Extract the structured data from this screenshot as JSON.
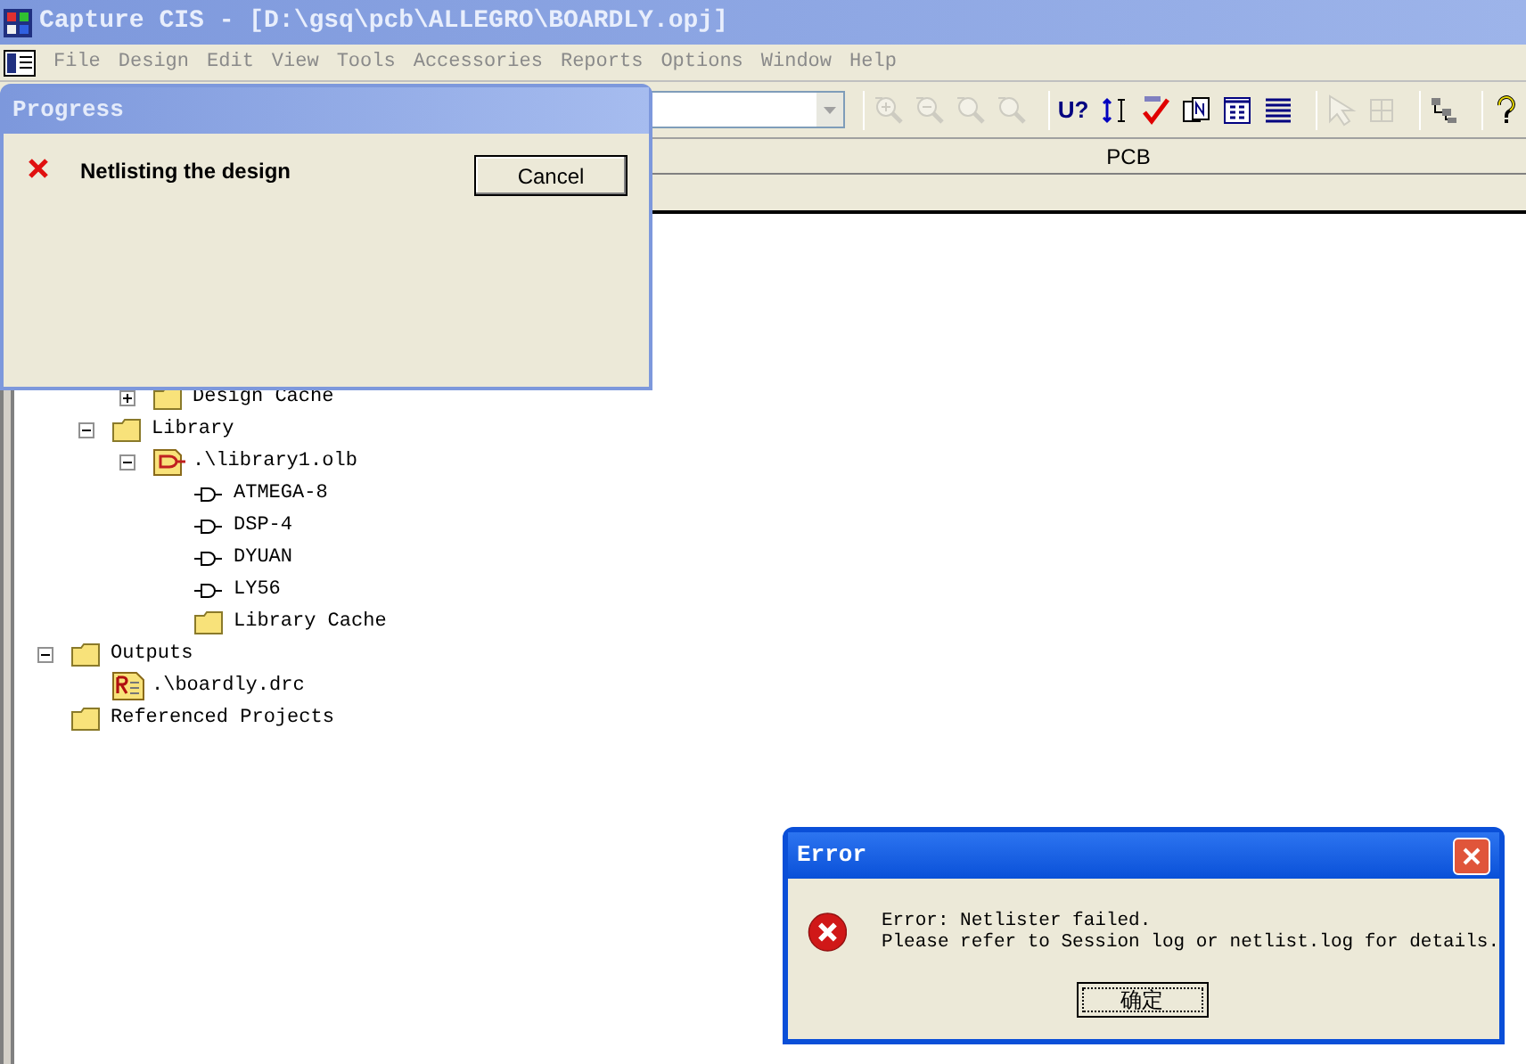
{
  "window": {
    "title": "Capture CIS - [D:\\gsq\\pcb\\ALLEGRO\\BOARDLY.opj]"
  },
  "menu": [
    {
      "label": "File",
      "disabled": true
    },
    {
      "label": "Design",
      "disabled": true
    },
    {
      "label": "Edit",
      "disabled": true
    },
    {
      "label": "View",
      "disabled": true
    },
    {
      "label": "Tools",
      "disabled": true
    },
    {
      "label": "Accessories",
      "disabled": true
    },
    {
      "label": "Reports",
      "disabled": true
    },
    {
      "label": "Options",
      "disabled": true
    },
    {
      "label": "Window",
      "disabled": true
    },
    {
      "label": "Help",
      "disabled": true
    }
  ],
  "toolbar": [
    {
      "kind": "zoom-in",
      "disabled": true
    },
    {
      "kind": "zoom-out",
      "disabled": true
    },
    {
      "kind": "zoom-area",
      "disabled": true
    },
    {
      "kind": "zoom-all",
      "disabled": true
    },
    {
      "kind": "text",
      "label": "U?",
      "disabled": false
    },
    {
      "kind": "spacing",
      "disabled": false
    },
    {
      "kind": "check",
      "disabled": false
    },
    {
      "kind": "netlist",
      "disabled": false
    },
    {
      "kind": "list",
      "disabled": false
    },
    {
      "kind": "table",
      "disabled": false
    },
    {
      "kind": "pointer",
      "disabled": true
    },
    {
      "kind": "part",
      "disabled": true
    },
    {
      "kind": "hierarchy",
      "disabled": false
    },
    {
      "kind": "help",
      "disabled": false
    }
  ],
  "project": {
    "header": "PCB"
  },
  "tree": {
    "items": [
      {
        "children": [
          {
            "children": [
              {
                "label": "Design Cache",
                "kind": "folder",
                "expanded": false
              }
            ]
          },
          {
            "label": "Library",
            "kind": "folder",
            "expanded": true,
            "children": [
              {
                "label": ".\\library1.olb",
                "kind": "library",
                "expanded": true,
                "children": [
                  {
                    "label": "ATMEGA-8",
                    "kind": "part"
                  },
                  {
                    "label": "DSP-4",
                    "kind": "part"
                  },
                  {
                    "label": "DYUAN",
                    "kind": "part"
                  },
                  {
                    "label": "LY56",
                    "kind": "part"
                  },
                  {
                    "label": "Library Cache",
                    "kind": "folder"
                  }
                ]
              }
            ]
          }
        ]
      },
      {
        "label": "Outputs",
        "kind": "folder",
        "expanded": true,
        "children": [
          {
            "label": ".\\boardly.drc",
            "kind": "report"
          }
        ]
      },
      {
        "label": "Referenced Projects",
        "kind": "folder"
      }
    ]
  },
  "progress": {
    "title": "Progress",
    "message": "Netlisting the design",
    "button": "Cancel"
  },
  "error": {
    "title": "Error",
    "lines": [
      "Error: Netlister failed.",
      "Please refer to Session log or netlist.log for details."
    ],
    "button": "确定"
  }
}
